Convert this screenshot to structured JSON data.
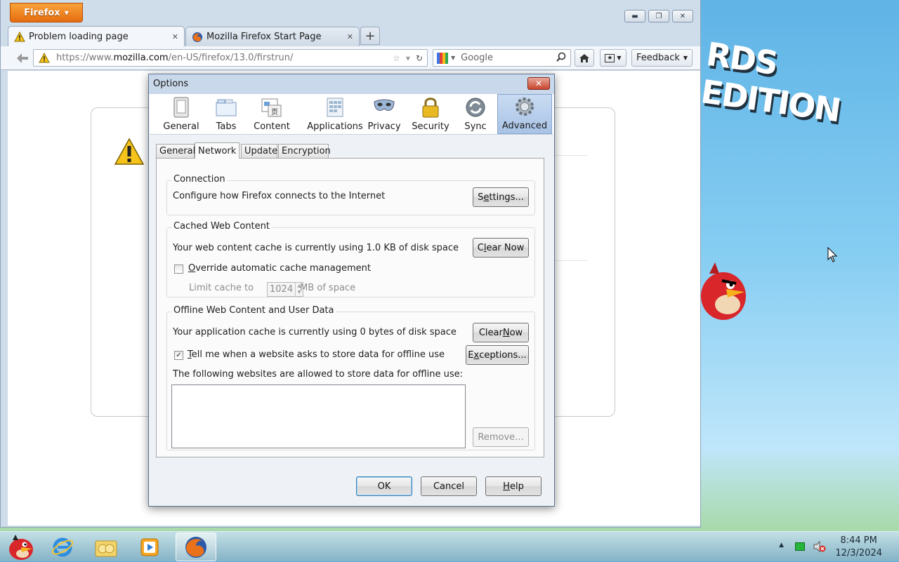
{
  "desktop": {
    "banner_text": "RDS EDITION"
  },
  "browser": {
    "menu_button_label": "Firefox",
    "tabs": [
      {
        "label": "Problem loading page",
        "close": "✕"
      },
      {
        "label": "Mozilla Firefox Start Page",
        "close": "✕"
      }
    ],
    "new_tab": "+",
    "url_prefix": "https://www.",
    "url_domain": "mozilla.com",
    "url_path": "/en-US/firefox/13.0/firstrun/",
    "search_placeholder": "Google",
    "feedback_label": "Feedback"
  },
  "dialog": {
    "title": "Options",
    "panes": [
      {
        "label": "General"
      },
      {
        "label": "Tabs"
      },
      {
        "label": "Content"
      },
      {
        "label": "Applications"
      },
      {
        "label": "Privacy"
      },
      {
        "label": "Security"
      },
      {
        "label": "Sync"
      },
      {
        "label": "Advanced"
      }
    ],
    "subtabs": [
      "General",
      "Network",
      "Update",
      "Encryption"
    ],
    "connection": {
      "title": "Connection",
      "text": "Configure how Firefox connects to the Internet",
      "settings_pre": "S",
      "settings_key": "e",
      "settings_post": "ttings..."
    },
    "cache": {
      "title": "Cached Web Content",
      "text": "Your web content cache is currently using 1.0 KB of disk space",
      "clear_pre": "C",
      "clear_key": "l",
      "clear_post": "ear Now",
      "override_key": "O",
      "override_post": "verride automatic cache management",
      "override_checked": false,
      "limit_label": "Limit cache to",
      "limit_value": "1024",
      "limit_unit": "MB of space"
    },
    "offline": {
      "title": "Offline Web Content and User Data",
      "text": "Your application cache is currently using 0 bytes of disk space",
      "clear_pre": "Clear ",
      "clear_key": "N",
      "clear_post": "ow",
      "tell_key": "T",
      "tell_post": "ell me when a website asks to store data for offline use",
      "tell_checked": true,
      "exceptions_pre": "E",
      "exceptions_key": "x",
      "exceptions_post": "ceptions...",
      "list_label": "The following websites are allowed to store data for offline use:",
      "remove_label": "Remove..."
    },
    "buttons": {
      "ok": "OK",
      "cancel": "Cancel",
      "help_key": "H",
      "help_post": "elp"
    }
  },
  "taskbar": {
    "time": "8:44 PM",
    "date": "12/3/2024"
  },
  "colors": {
    "firefox_orange": "#e66c0f",
    "dialog_title_bar": "#c9d8ea",
    "selected_pane": "#a9c3e6"
  }
}
